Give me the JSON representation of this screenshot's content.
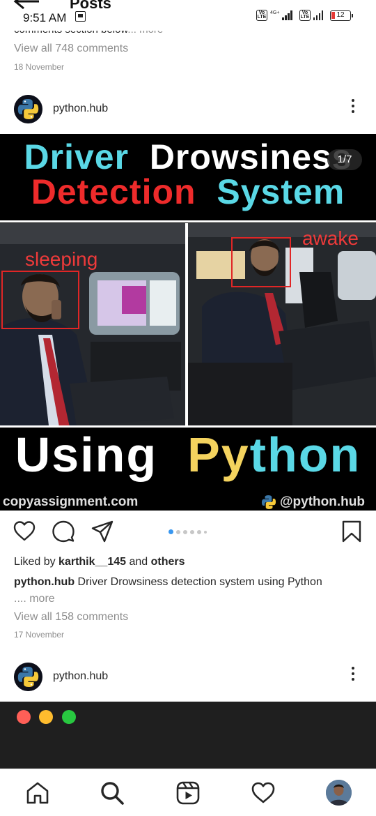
{
  "status_bar": {
    "time": "9:51 AM",
    "network": "4G+",
    "volte1": "Vo LTE",
    "volte2": "Vo LTE",
    "battery": "12"
  },
  "header": {
    "title": "Posts"
  },
  "previous_post": {
    "caption_tail": "comments section below",
    "more_label": "... more",
    "view_comments": "View all 748 comments",
    "date": "18 November"
  },
  "post": {
    "username": "python.hub",
    "image": {
      "title_word1": "Driver",
      "title_word2": "Drowsiness",
      "title_word3": "Detection",
      "title_word4": "System",
      "carousel_counter": "1/7",
      "label_sleeping": "sleeping",
      "label_awake": "awake",
      "using_word": "Using",
      "py_word": "Py",
      "thon_word": "thon",
      "footer_site": "copyassignment.com",
      "footer_handle": "@python.hub"
    },
    "likes": {
      "prefix": "Liked by ",
      "user": "karthik__145",
      "middle": " and ",
      "others": "others"
    },
    "caption": {
      "user": "python.hub",
      "text": " Driver Drowsiness detection system using Python",
      "more": ".... more"
    },
    "view_comments": "View all 158 comments",
    "date": "17 November",
    "carousel_dots_total": 6,
    "carousel_dots_active": 1
  },
  "next_post": {
    "username": "python.hub"
  },
  "colors": {
    "accent_blue": "#3897f0",
    "title_cyan": "#5ad8e6",
    "title_red": "#ee2b2b",
    "title_yellow": "#f4d35e",
    "muted_text": "#8e8e8e"
  },
  "bottom_nav": {
    "items": [
      "home-icon",
      "search-icon",
      "reels-icon",
      "heart-icon",
      "profile-avatar"
    ]
  }
}
